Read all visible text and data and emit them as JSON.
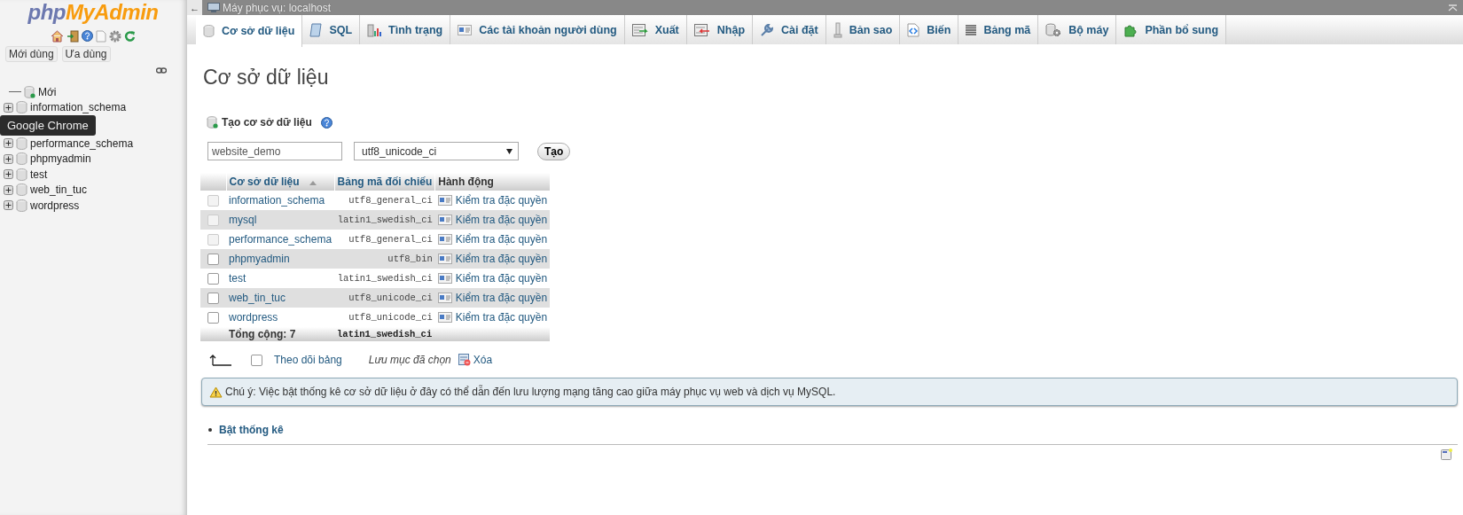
{
  "sidebar": {
    "logo_left": "php",
    "logo_right": "MyAdmin",
    "buttons": [
      "Mới dùng",
      "Ưa dùng"
    ],
    "tree": [
      {
        "kind": "new",
        "label": "Mới"
      },
      {
        "kind": "db",
        "label": "information_schema"
      },
      {
        "kind": "tooltip",
        "label": "Google Chrome"
      },
      {
        "kind": "db",
        "label": "performance_schema"
      },
      {
        "kind": "db",
        "label": "phpmyadmin"
      },
      {
        "kind": "db",
        "label": "test"
      },
      {
        "kind": "db",
        "label": "web_tin_tuc"
      },
      {
        "kind": "db",
        "label": "wordpress"
      }
    ]
  },
  "topbar": {
    "back": "←",
    "title": "Máy phục vụ: localhost"
  },
  "tabs": [
    {
      "label": "Cơ sở dữ liệu",
      "selected": true
    },
    {
      "label": "SQL",
      "selected": false
    },
    {
      "label": "Tình trạng",
      "selected": false
    },
    {
      "label": "Các tài khoản người dùng",
      "selected": false
    },
    {
      "label": "Xuất",
      "selected": false
    },
    {
      "label": "Nhập",
      "selected": false
    },
    {
      "label": "Cài đặt",
      "selected": false
    },
    {
      "label": "Bản sao",
      "selected": false
    },
    {
      "label": "Biến",
      "selected": false
    },
    {
      "label": "Bảng mã",
      "selected": false
    },
    {
      "label": "Bộ máy",
      "selected": false
    },
    {
      "label": "Phần bổ sung",
      "selected": false
    }
  ],
  "page_title": "Cơ sở dữ liệu",
  "create": {
    "label": "Tạo cơ sở dữ liệu",
    "name_value": "website_demo",
    "collation_value": "utf8_unicode_ci",
    "button": "Tạo"
  },
  "table": {
    "columns": [
      "Cơ sở dữ liệu",
      "Bảng mã đối chiếu",
      "Hành động"
    ],
    "rows": [
      {
        "name": "information_schema",
        "collation": "utf8_general_ci",
        "action": "Kiểm tra đặc quyền",
        "checked": false,
        "disabled": true
      },
      {
        "name": "mysql",
        "collation": "latin1_swedish_ci",
        "action": "Kiểm tra đặc quyền",
        "checked": false,
        "disabled": true
      },
      {
        "name": "performance_schema",
        "collation": "utf8_general_ci",
        "action": "Kiểm tra đặc quyền",
        "checked": false,
        "disabled": true
      },
      {
        "name": "phpmyadmin",
        "collation": "utf8_bin",
        "action": "Kiểm tra đặc quyền",
        "checked": false,
        "disabled": false
      },
      {
        "name": "test",
        "collation": "latin1_swedish_ci",
        "action": "Kiểm tra đặc quyền",
        "checked": false,
        "disabled": false
      },
      {
        "name": "web_tin_tuc",
        "collation": "utf8_unicode_ci",
        "action": "Kiểm tra đặc quyền",
        "checked": false,
        "disabled": false
      },
      {
        "name": "wordpress",
        "collation": "utf8_unicode_ci",
        "action": "Kiểm tra đặc quyền",
        "checked": false,
        "disabled": false
      }
    ],
    "total": "Tổng cộng: 7",
    "total_collation": "latin1_swedish_ci"
  },
  "bulk": {
    "check_all": "Theo dõi bảng",
    "check_all_checked": false,
    "with_selected": "Lưu mục đã chọn",
    "delete": "Xóa"
  },
  "notice": "Chú ý: Việc bật thống kê cơ sở dữ liệu ở đây có thể dẫn đến lưu lượng mạng tăng cao giữa máy phục vụ web và dịch vụ MySQL.",
  "enable_stats": "Bật thống kê"
}
